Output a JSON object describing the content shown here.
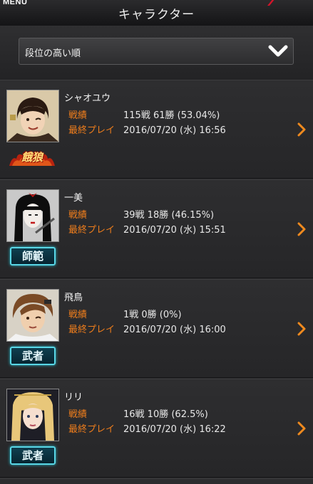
{
  "header": {
    "menu_label": "MENU",
    "title": "キャラクター"
  },
  "sort": {
    "selected": "段位の高い順",
    "icon": "chevron-down-icon"
  },
  "labels": {
    "record": "戦績",
    "last_played": "最終プレイ"
  },
  "colors": {
    "accent_orange": "#ee7d1c",
    "badge_cyan": "#59d7e6"
  },
  "characters": [
    {
      "name": "シャオユウ",
      "rank": "餓狼",
      "record": "115戦 61勝 (53.04%)",
      "last_played": "2016/07/20 (水) 16:56"
    },
    {
      "name": "一美",
      "rank": "師範",
      "record": "39戦 18勝 (46.15%)",
      "last_played": "2016/07/20 (水) 15:51"
    },
    {
      "name": "飛鳥",
      "rank": "武者",
      "record": "1戦 0勝 (0%)",
      "last_played": "2016/07/20 (水) 16:00"
    },
    {
      "name": "リリ",
      "rank": "武者",
      "record": "16戦 10勝 (62.5%)",
      "last_played": "2016/07/20 (水) 16:22"
    }
  ]
}
